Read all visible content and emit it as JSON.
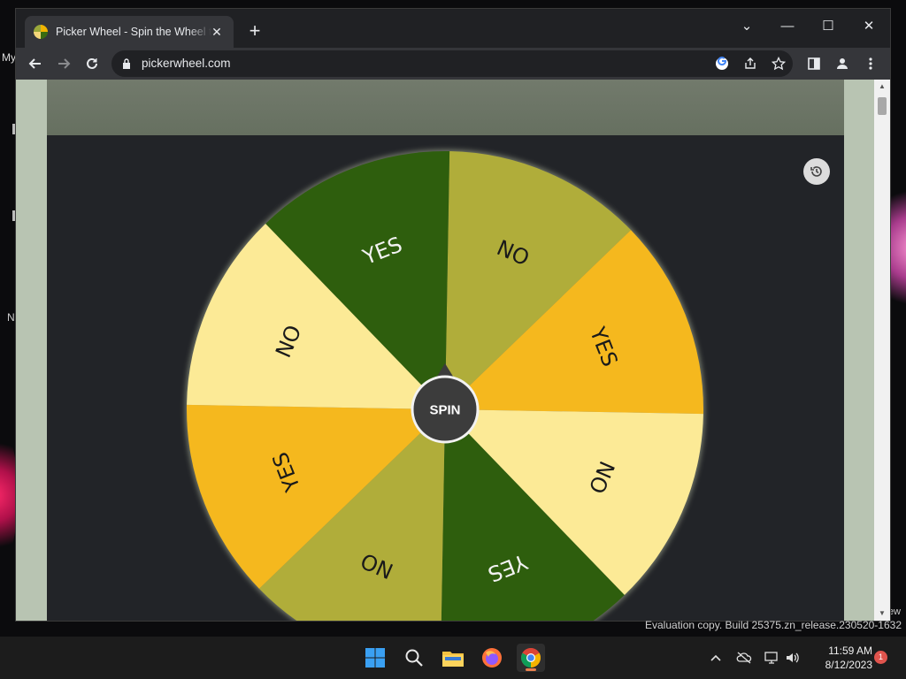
{
  "desktop": {
    "left_text": "My",
    "left_text_2": "N",
    "right_text": "ew",
    "watermark": "Evaluation copy. Build 25375.zn_release.230520-1632"
  },
  "browser": {
    "tab_title": "Picker Wheel - Spin the Wheel to",
    "tab_close": "✕",
    "new_tab": "+",
    "url": "pickerwheel.com",
    "window_controls": {
      "dropdown": "⌄",
      "minimize": "—",
      "maximize": "☐",
      "close": "✕"
    }
  },
  "wheel": {
    "center_label": "SPIN",
    "segments": [
      {
        "label": "NO",
        "color": "#b0ad3a"
      },
      {
        "label": "YES",
        "color": "#f5b81e"
      },
      {
        "label": "NO",
        "color": "#fcea96"
      },
      {
        "label": "YES",
        "color": "#2e5e0d"
      },
      {
        "label": "NO",
        "color": "#b0ad3a"
      },
      {
        "label": "YES",
        "color": "#f5b81e"
      },
      {
        "label": "NO",
        "color": "#fcea96"
      },
      {
        "label": "YES",
        "color": "#2e5e0d"
      }
    ]
  },
  "taskbar": {
    "clock_time": "11:59 AM",
    "clock_date": "8/12/2023",
    "notification_count": "1"
  },
  "colors": {
    "page_bg": "#222428",
    "header_band": "#6c7466",
    "spin_button": "#3c3c3c",
    "side_margin": "#b8c4b2"
  }
}
